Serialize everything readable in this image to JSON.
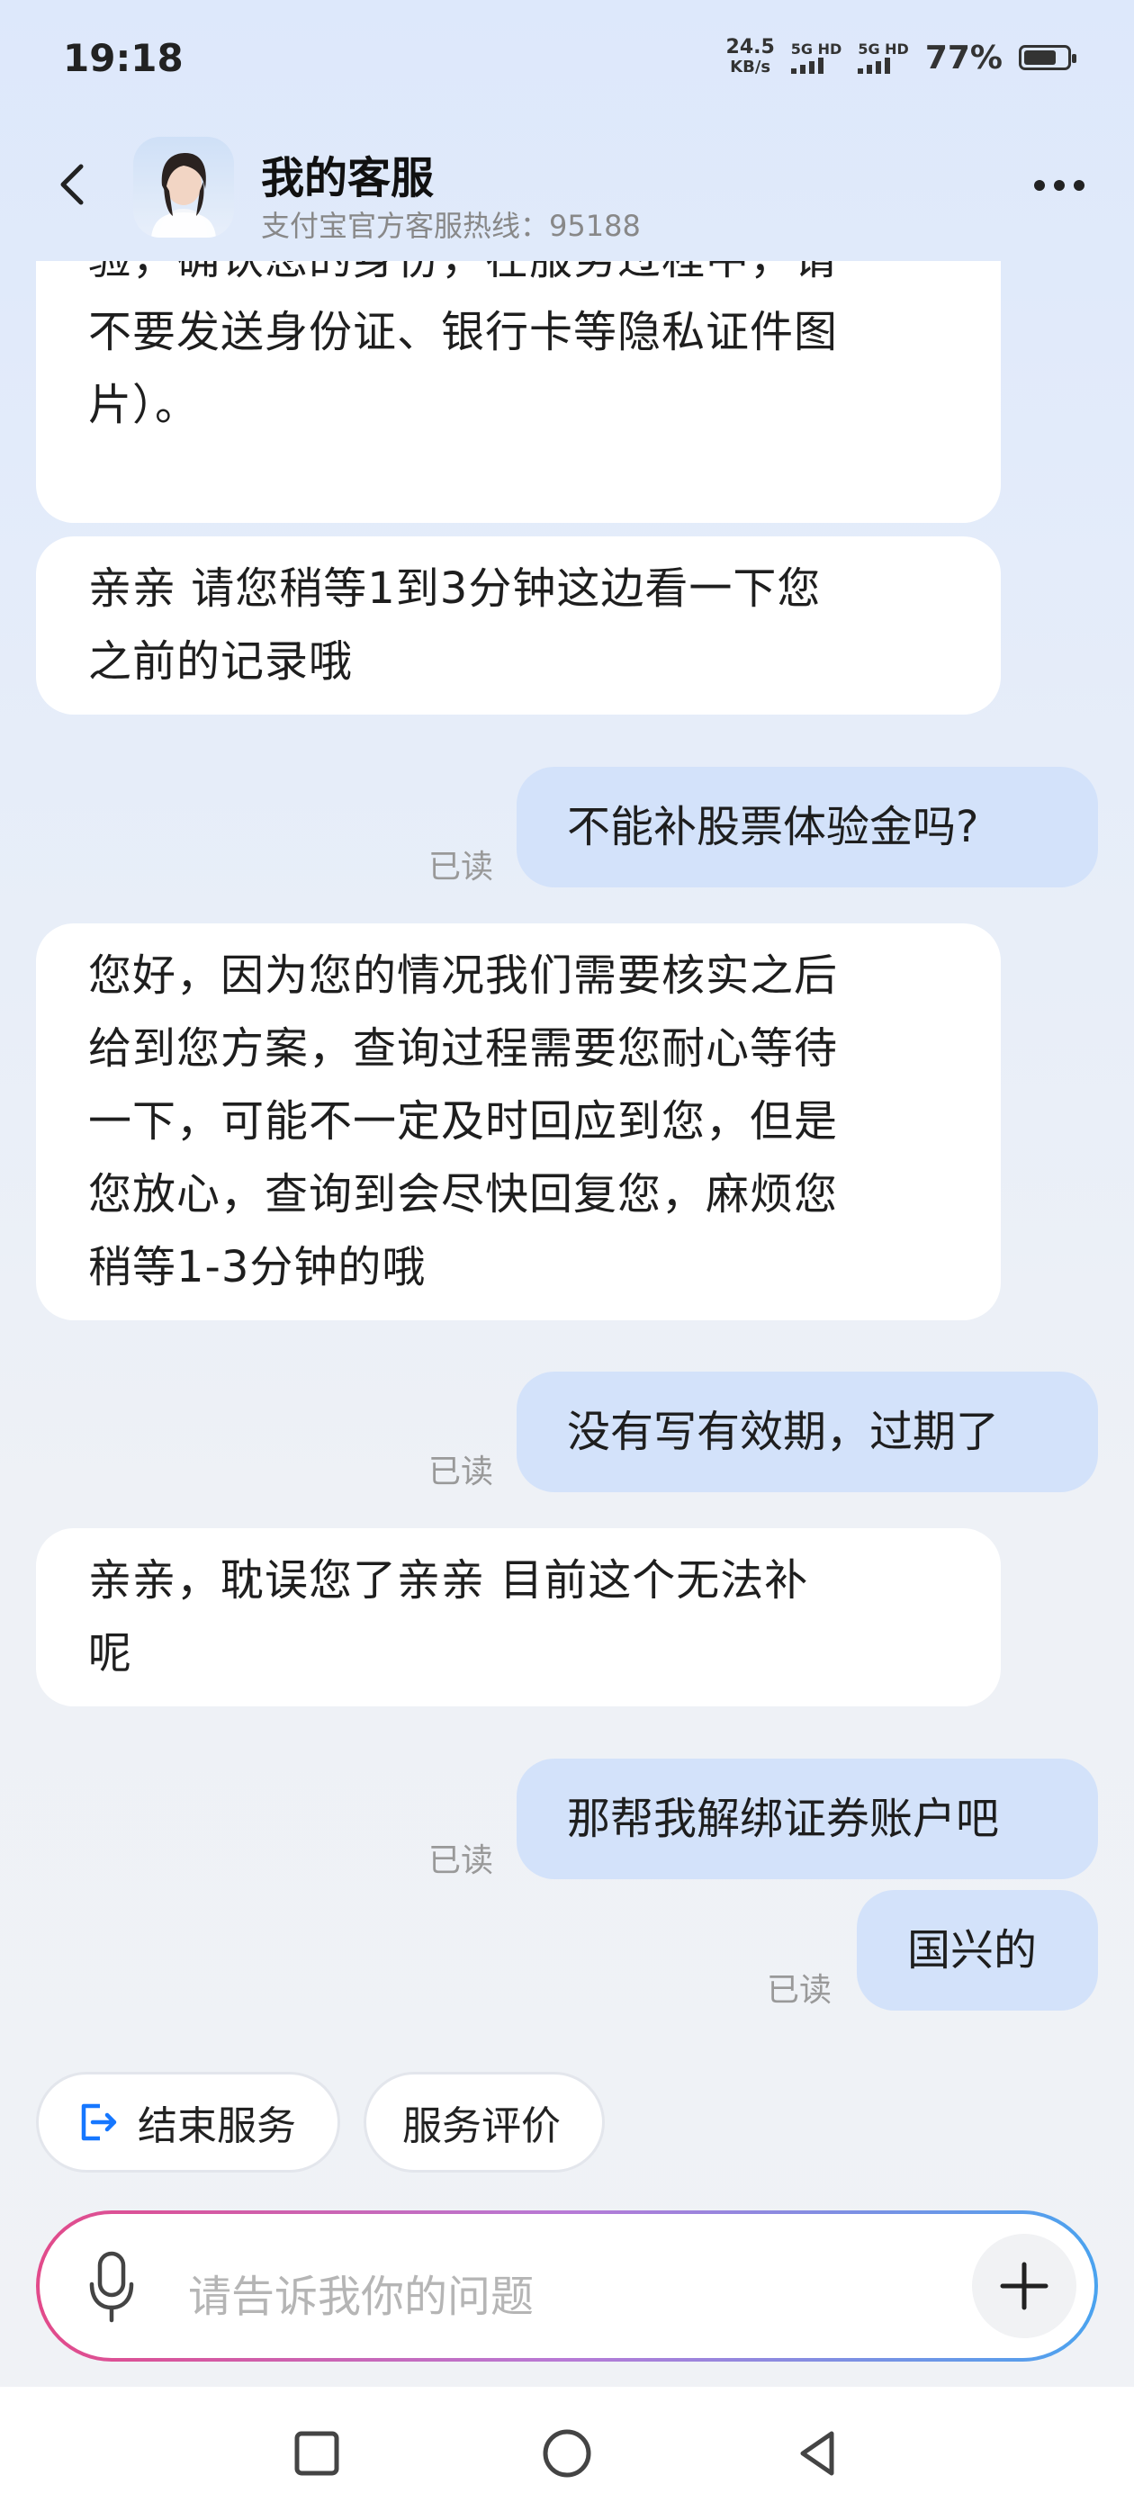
{
  "status_bar": {
    "time": "19:18",
    "net_speed_value": "24.5",
    "net_speed_unit": "KB/s",
    "sim1": "5G HD",
    "sim2": "5G HD",
    "battery": "77%",
    "battery_level": 0.77
  },
  "header": {
    "title": "我的客服",
    "subtitle": "支付宝官方客服热线：95188"
  },
  "messages": [
    {
      "side": "left",
      "text": "您符合以上的服务，这将系统安全核验，确认您的身份，在服务过程中，请不要发送身份证、银行卡等隐私证件图片）。"
    },
    {
      "side": "left",
      "text": "亲亲 请您稍等1到3分钟这边看一下您之前的记录哦"
    },
    {
      "side": "right",
      "text": "不能补股票体验金吗?",
      "read": "已读"
    },
    {
      "side": "left",
      "text": "您好，因为您的情况我们需要核实之后给到您方案，查询过程需要您耐心等待一下，可能不一定及时回应到您，但是您放心，查询到会尽快回复您，麻烦您稍等1-3分钟的哦"
    },
    {
      "side": "right",
      "text": "没有写有效期，过期了",
      "read": "已读"
    },
    {
      "side": "left",
      "text": "亲亲，耽误您了亲亲 目前这个无法补呢"
    },
    {
      "side": "right",
      "text": "那帮我解绑证券账户吧",
      "read": "已读"
    },
    {
      "side": "right",
      "text": "国兴的",
      "read": "已读"
    }
  ],
  "msg0_lines": [
    "验，确认您的身份，在服务过程中，请",
    "不要发送身份证、银行卡等隐私证件图",
    "片）。"
  ],
  "msg1_lines": [
    "亲亲 请您稍等1到3分钟这边看一下您",
    "之前的记录哦"
  ],
  "msg3_lines": [
    "您好，因为您的情况我们需要核实之后",
    "给到您方案，查询过程需要您耐心等待",
    "一下，可能不一定及时回应到您，但是",
    "您放心，查询到会尽快回复您，麻烦您",
    "稍等1-3分钟的哦"
  ],
  "msg5_lines": [
    "亲亲，耽误您了亲亲 目前这个无法补",
    "呢"
  ],
  "quick_actions": {
    "end_service": "结束服务",
    "rate_service": "服务评价"
  },
  "input": {
    "placeholder": "请告诉我你的问题"
  },
  "icons": {
    "back": "back-arrow-icon",
    "more": "more-dots-icon",
    "mic": "microphone-icon",
    "plus": "plus-icon",
    "exit": "exit-icon"
  },
  "colors": {
    "user_bubble": "#d3e2fa",
    "agent_bubble": "#ffffff",
    "accent_blue": "#1677ff"
  }
}
